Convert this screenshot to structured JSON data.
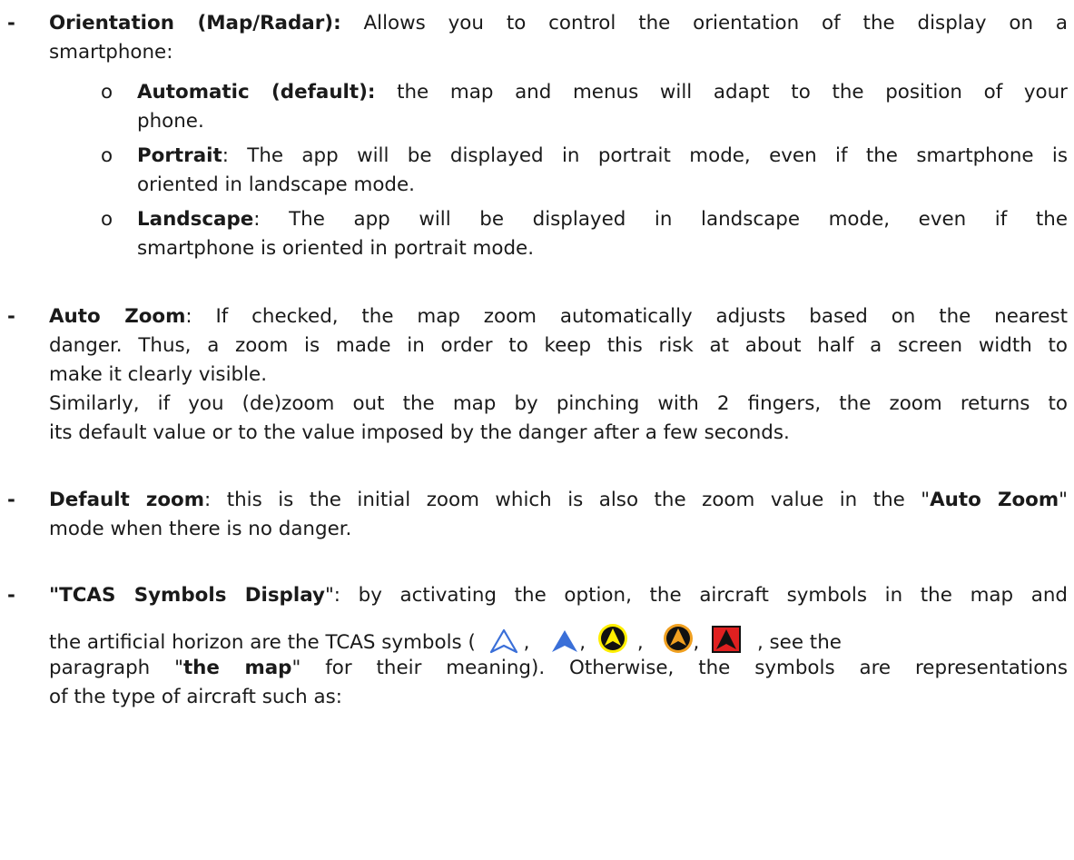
{
  "bullet": "-",
  "sub_bullet": "o",
  "orientation": {
    "label": "Orientation (Map/Radar):",
    "line1": "Allows you to control the orientation of the display on a",
    "line2": "smartphone:",
    "items": [
      {
        "label": "Automatic (default):",
        "line1": "the map and menus will adapt to the position of your",
        "line2": "phone."
      },
      {
        "label": "Portrait",
        "line1": ": The app will be displayed in portrait mode, even if the smartphone is",
        "line2": "oriented in landscape mode."
      },
      {
        "label": "Landscape",
        "line1": ": The app will be displayed in landscape mode, even if the",
        "line2": "smartphone is oriented in portrait mode."
      }
    ]
  },
  "auto_zoom": {
    "label": "Auto Zoom",
    "line1": ": If checked, the map zoom automatically adjusts based on the nearest",
    "line2": "danger. Thus, a zoom is made in order to keep this risk at about half a screen width to",
    "line3": "make it clearly visible.",
    "line4": "Similarly, if you (de)zoom out the map by pinching with 2 fingers, the zoom returns to",
    "line5": "its default value or to the value imposed by the danger after a few seconds."
  },
  "default_zoom": {
    "label": "Default zoom",
    "line1_a": ": this is the initial zoom which is also the zoom value in the \"",
    "line1_b": "Auto Zoom",
    "line1_c": "\"",
    "line2": "mode when there is no danger."
  },
  "tcas": {
    "label": "\"TCAS Symbols Display",
    "line1": "\": by activating the option, the aircraft symbols in the map and",
    "line2_a": "the artificial horizon are the TCAS symbols (",
    "comma": ",",
    "line2_b": ", see the",
    "line3_a": "paragraph \"",
    "line3_b": "the map",
    "line3_c": "\" for their meaning). Otherwise, the symbols are representations",
    "line4": "of the type of aircraft such as:",
    "symbols": [
      "other-traffic-outline-icon",
      "proximate-traffic-icon",
      "traffic-advisory-yellow-icon",
      "traffic-advisory-orange-icon",
      "resolution-advisory-red-icon"
    ],
    "colors": {
      "blue": "#3a6fd8",
      "yellow": "#ffee00",
      "orange": "#f0a020",
      "red": "#e02020",
      "black": "#111111"
    }
  }
}
